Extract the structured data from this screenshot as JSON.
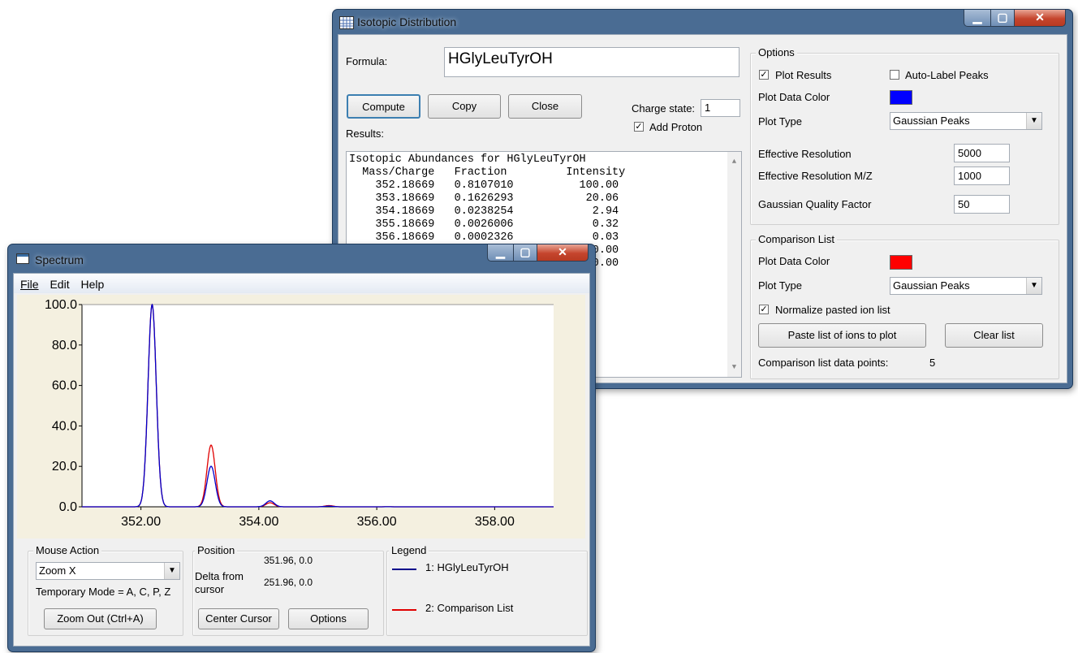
{
  "iso": {
    "title": "Isotopic Distribution",
    "formula_label": "Formula:",
    "formula_value": "HGlyLeuTyrOH",
    "compute_label": "Compute",
    "copy_label": "Copy",
    "close_label": "Close",
    "charge_label": "Charge state:",
    "charge_value": "1",
    "add_proton_label": "Add Proton",
    "add_proton_checked": true,
    "results_label": "Results:",
    "results_text": "Isotopic Abundances for HGlyLeuTyrOH\n  Mass/Charge   Fraction         Intensity\n    352.18669   0.8107010          100.00\n    353.18669   0.1626293           20.06\n    354.18669   0.0238254            2.94\n    355.18669   0.0026006            0.32\n    356.18669   0.0002326            0.03\n    357.18669   0.0000176            0.00\n    358.18669   0.0000012            0.00",
    "options": {
      "title": "Options",
      "plot_results_label": "Plot Results",
      "plot_results_checked": true,
      "auto_label_label": "Auto-Label Peaks",
      "auto_label_checked": false,
      "plot_color_label": "Plot Data Color",
      "plot_color": "#0000ff",
      "plot_type_label": "Plot Type",
      "plot_type_value": "Gaussian Peaks",
      "eff_res_label": "Effective Resolution",
      "eff_res_value": "5000",
      "eff_res_mz_label": "Effective Resolution M/Z",
      "eff_res_mz_value": "1000",
      "gauss_label": "Gaussian Quality Factor",
      "gauss_value": "50"
    },
    "comparison": {
      "title": "Comparison List",
      "plot_color_label": "Plot Data Color",
      "plot_color": "#ff0000",
      "plot_type_label": "Plot Type",
      "plot_type_value": "Gaussian Peaks",
      "normalize_label": "Normalize pasted ion list",
      "normalize_checked": true,
      "paste_label": "Paste list of ions to plot",
      "clear_label": "Clear list",
      "points_label": "Comparison list data points:",
      "points_value": "5"
    }
  },
  "spectrum": {
    "title": "Spectrum",
    "menu": [
      "File",
      "Edit",
      "Help"
    ],
    "mouse_action": {
      "title": "Mouse Action",
      "mode_value": "Zoom X",
      "temp_mode": "Temporary Mode = A, C, P, Z",
      "zoom_out_label": "Zoom Out (Ctrl+A)"
    },
    "position": {
      "title": "Position",
      "cursor_value": "351.96, 0.0",
      "delta_label": "Delta from cursor",
      "delta_value": "251.96, 0.0",
      "center_label": "Center Cursor",
      "options_label": "Options"
    },
    "legend": {
      "title": "Legend",
      "items": [
        {
          "label": "1: HGlyLeuTyrOH",
          "color": "#00008b"
        },
        {
          "label": "2: Comparison List",
          "color": "#e00000"
        }
      ]
    }
  },
  "chart_data": {
    "type": "line",
    "xlim": [
      351.0,
      359.0
    ],
    "ylim": [
      0,
      100
    ],
    "x_ticks": [
      "352.00",
      "354.00",
      "356.00",
      "358.00"
    ],
    "y_ticks": [
      "0.0",
      "20.0",
      "40.0",
      "60.0",
      "80.0",
      "100.0"
    ],
    "peak_width": 0.07,
    "series": [
      {
        "name": "1: HGlyLeuTyrOH",
        "color": "#0000cc",
        "peaks": [
          [
            352.19,
            100.0
          ],
          [
            353.19,
            20.06
          ],
          [
            354.19,
            2.94
          ],
          [
            355.19,
            0.32
          ],
          [
            356.19,
            0.03
          ]
        ]
      },
      {
        "name": "2: Comparison List",
        "color": "#e00000",
        "peaks": [
          [
            352.19,
            100.0
          ],
          [
            353.19,
            30.5
          ],
          [
            354.19,
            2.0
          ],
          [
            355.19,
            0.6
          ],
          [
            356.19,
            0.05
          ]
        ]
      }
    ]
  }
}
